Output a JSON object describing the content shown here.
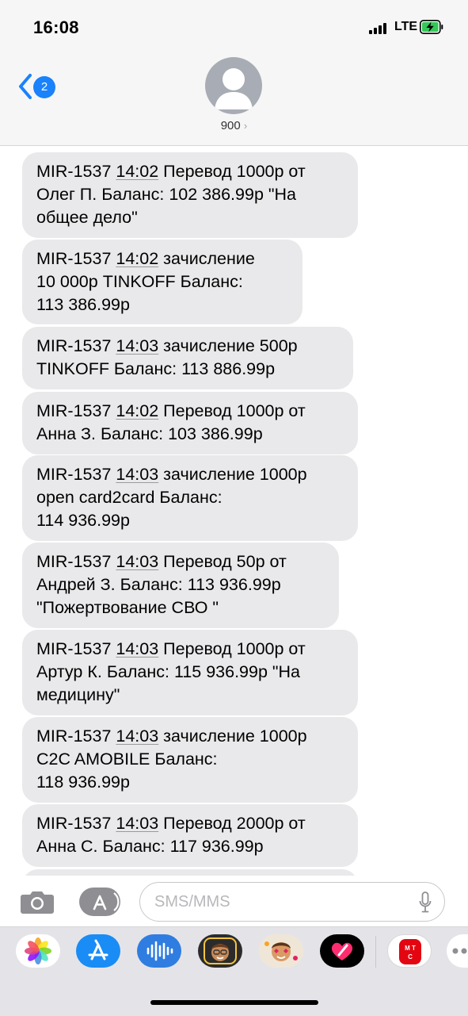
{
  "status_bar": {
    "time": "16:08",
    "network": "LTE",
    "battery_state": "charging",
    "battery_color": "#34c759"
  },
  "nav": {
    "back_badge": "2",
    "contact": "900",
    "accent_color": "#1a82fb"
  },
  "messages": [
    {
      "prefix": "MIR-1537 ",
      "time": "14:02",
      "line1_rest": " Перевод 1000р от",
      "line2": "Олег П. Баланс: 102 386.99р \"На",
      "line3": "общее дело\""
    },
    {
      "prefix": "MIR-1537 ",
      "time": "14:02",
      "line1_rest": " зачисление",
      "line2": "10 000р TINKOFF Баланс:",
      "line3": "113 386.99р"
    },
    {
      "prefix": "MIR-1537 ",
      "time": "14:03",
      "line1_rest": " зачисление 500р",
      "line2": "TINKOFF Баланс: 113 886.99р",
      "line3": ""
    },
    {
      "prefix": "MIR-1537 ",
      "time": "14:02",
      "line1_rest": " Перевод 1000р от",
      "line2": "Анна З. Баланс: 103 386.99р",
      "line3": ""
    },
    {
      "prefix": "MIR-1537 ",
      "time": "14:03",
      "line1_rest": " зачисление 1000р",
      "line2": "open card2card Баланс:",
      "line3": "114 936.99р"
    },
    {
      "prefix": "MIR-1537 ",
      "time": "14:03",
      "line1_rest": " Перевод 50р от",
      "line2": "Андрей З. Баланс: 113 936.99р",
      "line3": "\"Пожертвование СВО \""
    },
    {
      "prefix": "MIR-1537 ",
      "time": "14:03",
      "line1_rest": " Перевод 1000р от",
      "line2": "Артур К. Баланс: 115 936.99р \"На",
      "line3": "медицину\""
    },
    {
      "prefix": "MIR-1537 ",
      "time": "14:03",
      "line1_rest": " зачисление 1000р",
      "line2": "C2C AMOBILE Баланс:",
      "line3": "118 936.99р"
    },
    {
      "prefix": "MIR-1537 ",
      "time": "14:03",
      "line1_rest": " Перевод 2000р от",
      "line2": "Анна С. Баланс: 117 936.99р",
      "line3": ""
    }
  ],
  "compose": {
    "placeholder": "SMS/MMS"
  },
  "app_drawer": {
    "apps": [
      "photos-icon",
      "app-store-icon",
      "audio-message-icon",
      "memoji-icon",
      "memoji-stickers-icon",
      "digital-touch-icon",
      "mts-app-icon",
      "more-apps-icon"
    ]
  }
}
